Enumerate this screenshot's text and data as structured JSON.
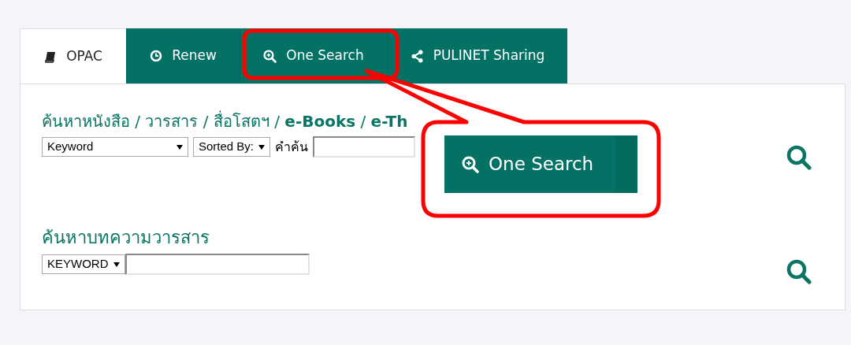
{
  "tabs": [
    {
      "label": "OPAC",
      "selected": true
    },
    {
      "label": "Renew",
      "selected": false
    },
    {
      "label": "One Search",
      "selected": false
    },
    {
      "label": "PULINET Sharing",
      "selected": false
    }
  ],
  "book_search": {
    "heading": "ค้นหาหนังสือ / วารสาร / สื่อโสตฯ / **e-Books** / **e-Th**",
    "field_select": "Keyword",
    "sort_select": "Sorted By:",
    "query_label": "คำค้น"
  },
  "article_search": {
    "heading": "ค้นหาบทความวารสาร",
    "field_select": "KEYWORD"
  },
  "callout": {
    "label": "One Search"
  }
}
